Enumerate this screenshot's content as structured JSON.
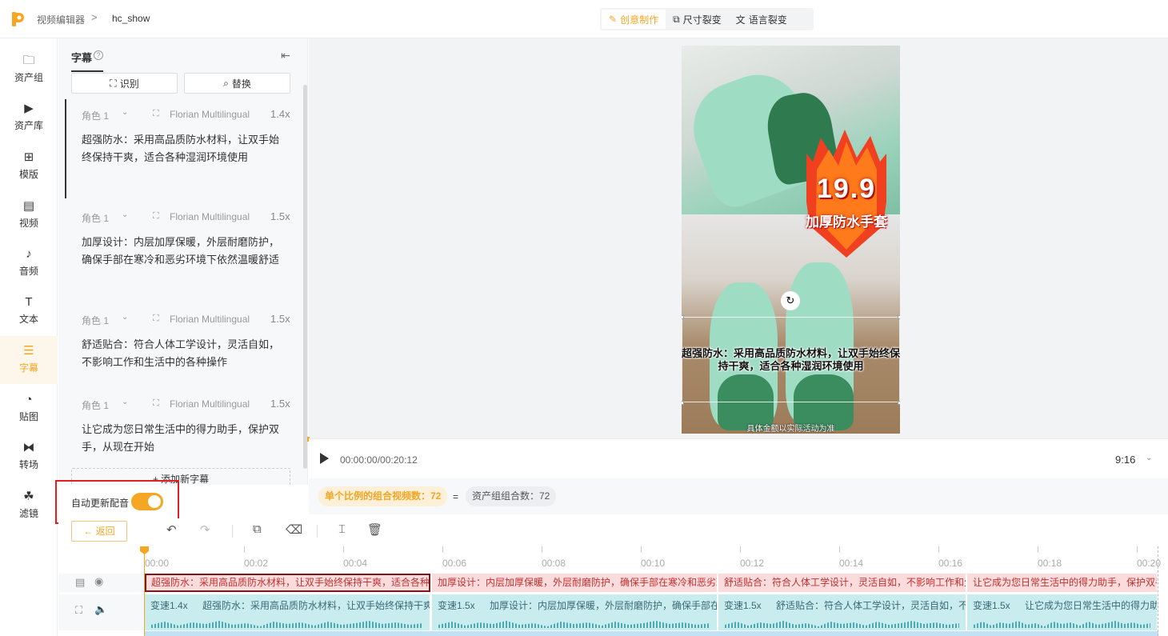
{
  "header": {
    "breadcrumb_root": "视频编辑器",
    "breadcrumb_sep": ">",
    "project_name": "hc_show",
    "modes": [
      {
        "label": "创意制作",
        "icon": "magic-wand-icon",
        "active": true
      },
      {
        "label": "尺寸裂变",
        "icon": "resize-icon",
        "active": false
      },
      {
        "label": "语言裂变",
        "icon": "translate-icon",
        "active": false
      }
    ]
  },
  "sidebar": {
    "items": [
      {
        "label": "资产组",
        "icon": "folder-icon"
      },
      {
        "label": "资产库",
        "icon": "play-square-icon"
      },
      {
        "label": "模版",
        "icon": "layout-icon"
      },
      {
        "label": "视频",
        "icon": "film-icon"
      },
      {
        "label": "音频",
        "icon": "music-note-icon"
      },
      {
        "label": "文本",
        "icon": "text-t-icon"
      },
      {
        "label": "字幕",
        "icon": "subtitle-icon"
      },
      {
        "label": "贴图",
        "icon": "sticker-icon"
      },
      {
        "label": "转场",
        "icon": "transition-icon"
      },
      {
        "label": "滤镜",
        "icon": "filter-icon"
      }
    ],
    "active_label": "字幕"
  },
  "subtitle_panel": {
    "title": "字幕",
    "recognize_label": "识别",
    "replace_label": "替换",
    "items": [
      {
        "role": "角色 1",
        "voice": "Florian Multilingual",
        "speed": "1.4x",
        "text": "超强防水：采用高品质防水材料，让双手始终保持干爽，适合各种湿润环境使用"
      },
      {
        "role": "角色 1",
        "voice": "Florian Multilingual",
        "speed": "1.5x",
        "text": "加厚设计：内层加厚保暖，外层耐磨防护，确保手部在寒冷和恶劣环境下依然温暖舒适"
      },
      {
        "role": "角色 1",
        "voice": "Florian Multilingual",
        "speed": "1.5x",
        "text": "舒适贴合：符合人体工学设计，灵活自如，不影响工作和生活中的各种操作"
      },
      {
        "role": "角色 1",
        "voice": "Florian Multilingual",
        "speed": "1.5x",
        "text": "让它成为您日常生活中的得力助手，保护双手，从现在开始"
      }
    ],
    "add_label": "+ 添加新字幕",
    "auto_dub_label": "自动更新配音",
    "auto_dub_on": true
  },
  "preview": {
    "price": "19.9",
    "price_caption": "加厚防水手套",
    "overlay_subtitle": "超强防水：采用高品质防水材料，让双手始终保持干爽，适合各种湿润环境使用",
    "disclaimer": "具体金额以实际活动为准",
    "time": "00:00:00/00:20:12",
    "ratio": "9:16"
  },
  "stats": {
    "combo_label": "单个比例的组合视频数：72",
    "equals": "=",
    "group_label": "资产组组合数：72"
  },
  "timeline": {
    "back_label": "返回",
    "ruler": [
      "00:00",
      "00:02",
      "00:04",
      "00:06",
      "00:08",
      "00:10",
      "00:12",
      "00:14",
      "00:16",
      "00:18",
      "00:20"
    ],
    "subtitle_clips": [
      "超强防水：采用高品质防水材料，让双手始终保持干爽，适合各种湿润环境使用",
      "加厚设计：内层加厚保暖，外层耐磨防护，确保手部在寒冷和恶劣环境下依然温暖舒适",
      "舒适贴合：符合人体工学设计，灵活自如，不影响工作和生活中的各种操作",
      "让它成为您日常生活中的得力助手，保护双手，从现在开始"
    ],
    "audio_clips": [
      {
        "speed": "变速1.4x",
        "text": "超强防水：采用高品质防水材料，让双手始终保持干爽"
      },
      {
        "speed": "变速1.5x",
        "text": "加厚设计：内层加厚保暖，外层耐磨防护，确保手部在寒冷"
      },
      {
        "speed": "变速1.5x",
        "text": "舒适贴合：符合人体工学设计，灵活自如，不影响工作"
      },
      {
        "speed": "变速1.5x",
        "text": "让它成为您日常生活中的得力助手"
      }
    ]
  }
}
